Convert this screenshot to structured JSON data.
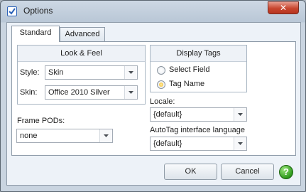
{
  "window": {
    "title": "Options",
    "close_glyph": "✕"
  },
  "tabs": [
    {
      "label": "Standard",
      "active": true
    },
    {
      "label": "Advanced",
      "active": false
    }
  ],
  "look_and_feel": {
    "header": "Look & Feel",
    "style_label": "Style:",
    "style_value": "Skin",
    "skin_label": "Skin:",
    "skin_value": "Office 2010 Silver"
  },
  "display_tags": {
    "header": "Display Tags",
    "options": [
      {
        "label": "Select Field",
        "checked": false
      },
      {
        "label": "Tag Name",
        "checked": true
      }
    ]
  },
  "frame_pods": {
    "label": "Frame PODs:",
    "value": "none"
  },
  "locale": {
    "label": "Locale:",
    "value": "{default}"
  },
  "autotag_language": {
    "label": "AutoTag interface language",
    "value": "{default}"
  },
  "buttons": {
    "ok": "OK",
    "cancel": "Cancel",
    "help": "?"
  },
  "colors": {
    "help_green": "#2f9a1d",
    "radio_checked": "#f3b11d",
    "close_red": "#c7462f"
  }
}
